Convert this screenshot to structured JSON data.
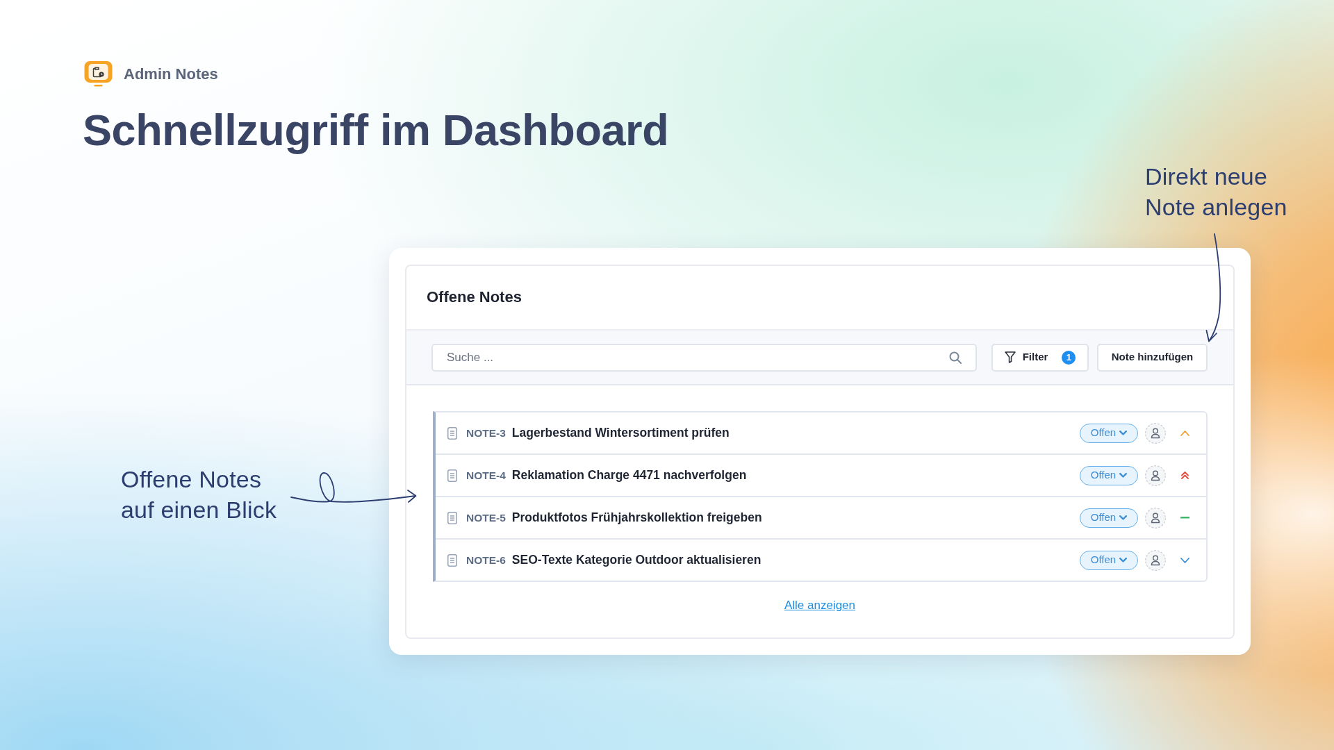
{
  "brand": {
    "name": "Admin Notes"
  },
  "headline": "Schnellzugriff im Dashboard",
  "panel": {
    "title": "Offene Notes",
    "search": {
      "placeholder": "Suche ..."
    },
    "filter": {
      "label": "Filter",
      "count": "1"
    },
    "add_button": "Note hinzufügen",
    "notes": [
      {
        "id": "NOTE-3",
        "title": "Lagerbestand Wintersortiment prüfen",
        "status": "Offen",
        "kind": "high"
      },
      {
        "id": "NOTE-4",
        "title": "Reklamation Charge 4471 nachverfolgen",
        "status": "Offen",
        "kind": "highest"
      },
      {
        "id": "NOTE-5",
        "title": "Produktfotos Frühjahrskollektion freigeben",
        "status": "Offen",
        "kind": "medium"
      },
      {
        "id": "NOTE-6",
        "title": "SEO-Texte Kategorie Outdoor aktualisieren",
        "status": "Offen",
        "kind": "low"
      }
    ],
    "show_all": "Alle anzeigen"
  },
  "annotations": [
    {
      "lines": [
        "Direkt neue",
        "Note anlegen"
      ],
      "kind": "down"
    },
    {
      "lines": [
        "Offene Notes",
        "auf einen Blick"
      ],
      "kind": "loop"
    }
  ]
}
